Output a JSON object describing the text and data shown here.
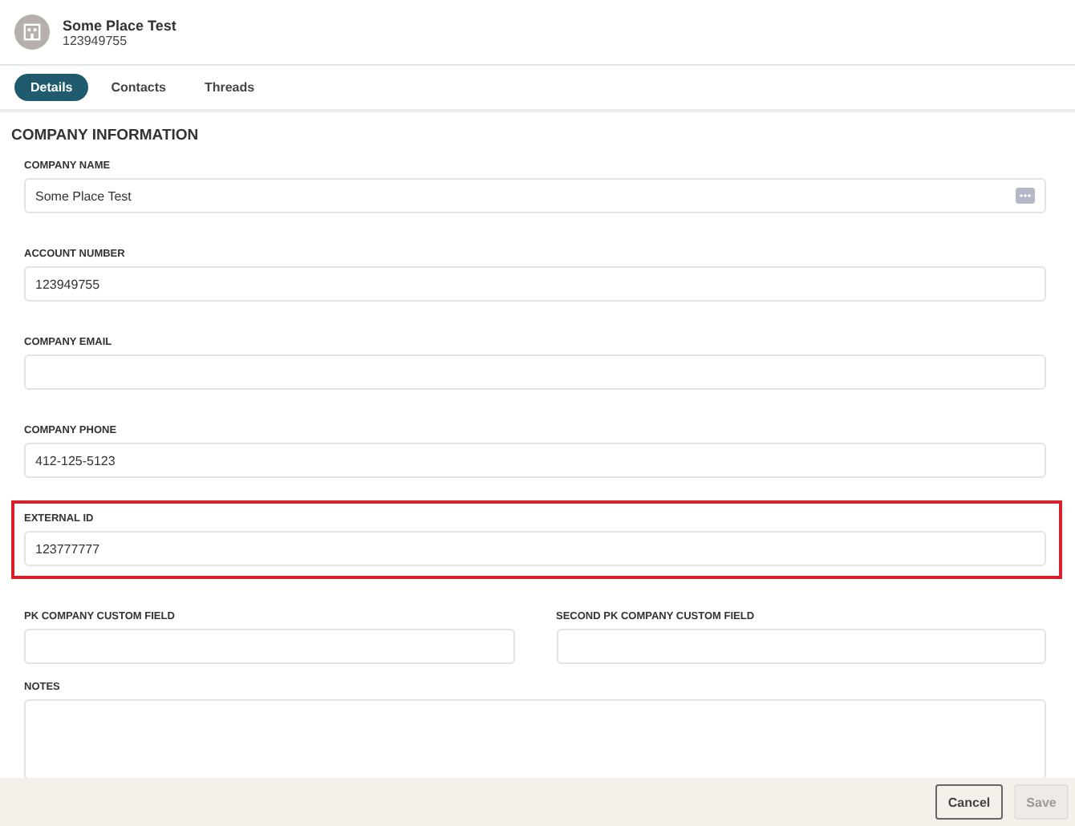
{
  "header": {
    "title": "Some Place Test",
    "subtitle": "123949755"
  },
  "tabs": [
    {
      "label": "Details",
      "selected": true
    },
    {
      "label": "Contacts",
      "selected": false
    },
    {
      "label": "Threads",
      "selected": false
    }
  ],
  "section_title": "COMPANY INFORMATION",
  "fields": [
    {
      "label": "COMPANY NAME",
      "value": "Some Place Test",
      "kind": "text",
      "has_menu": true,
      "highlighted": false,
      "half": false
    },
    {
      "label": "ACCOUNT NUMBER",
      "value": "123949755",
      "kind": "text",
      "has_menu": false,
      "highlighted": false,
      "half": false
    },
    {
      "label": "COMPANY EMAIL",
      "kind": "text",
      "has_menu": false,
      "highlighted": false,
      "half": false
    },
    {
      "label": "COMPANY PHONE",
      "value": "412-125-5123",
      "kind": "text",
      "has_menu": false,
      "highlighted": false,
      "half": false
    },
    {
      "label": "EXTERNAL ID",
      "value": "123777777",
      "kind": "text",
      "has_menu": false,
      "highlighted": true,
      "half": false
    },
    {
      "label": "PK COMPANY CUSTOM FIELD",
      "kind": "text",
      "has_menu": false,
      "highlighted": false,
      "half": true
    },
    {
      "label": "SECOND PK COMPANY CUSTOM FIELD",
      "kind": "text",
      "has_menu": false,
      "highlighted": false,
      "half": true
    },
    {
      "label": "NOTES",
      "kind": "textarea",
      "has_menu": false,
      "highlighted": false,
      "half": false
    }
  ],
  "buttons": [
    {
      "label": "Cancel",
      "disabled": false
    },
    {
      "label": "Save",
      "disabled": true
    }
  ]
}
